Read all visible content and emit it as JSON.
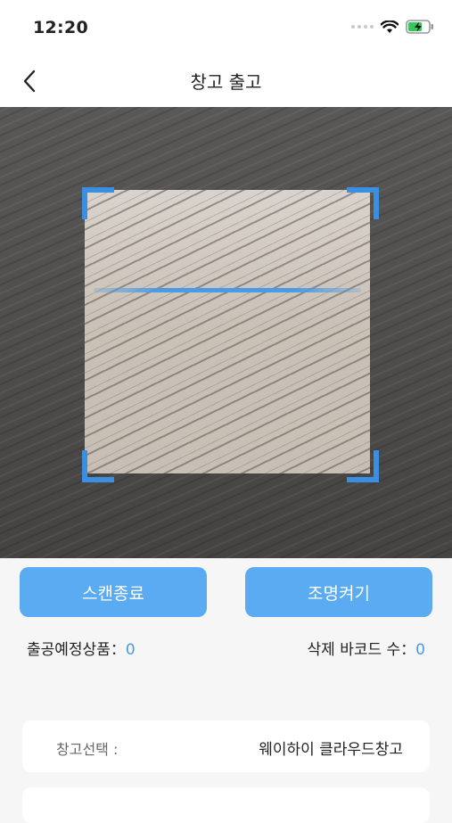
{
  "status_bar": {
    "time": "12:20"
  },
  "nav": {
    "title": "창고 출고"
  },
  "buttons": {
    "end_scan": "스캔종료",
    "light_on": "조명켜기"
  },
  "stats": {
    "expected_label": "출공예정상품：",
    "expected_count": "0",
    "deleted_label": "삭제 바코드 수：",
    "deleted_count": "0"
  },
  "warehouse": {
    "label": "창고선택 :",
    "value": "웨이하이 클라우드창고"
  },
  "colors": {
    "accent": "#5aabf2",
    "scan_frame": "#3b8fe3",
    "count": "#4a9be6"
  },
  "icons": [
    "back-icon",
    "wifi-icon",
    "battery-icon",
    "signal-icon"
  ]
}
